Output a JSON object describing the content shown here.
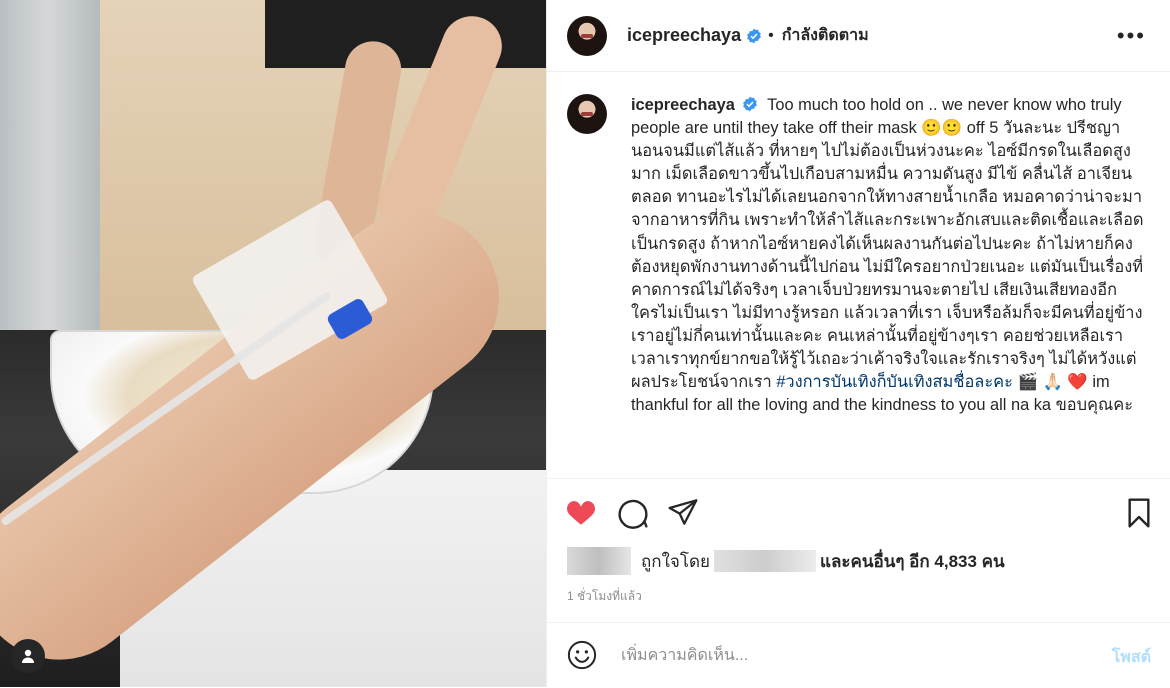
{
  "post": {
    "username": "icepreechaya",
    "follow_status": "กำลังติดตาม",
    "more_menu": "•••",
    "caption_username": "icepreechaya",
    "caption_body": "Too much too hold on .. we never know who truly people are until they take off their mask 🙂🙂 off 5 วันละนะ ปรีชญา นอนจนมีแต่ไส้แล้ว ที่หายๆ ไปไม่ต้องเป็นห่วงนะคะ ไอซ์มีกรดในเลือดสูงมาก เม็ดเลือดขาวขึ้นไปเกือบสามหมื่น ความดันสูง มีไข้ คลื่นไส้ อาเจียน ตลอด ทานอะไรไม่ได้เลยนอกจากให้ทางสายน้ำเกลือ หมอคาดว่าน่าจะมาจากอาหารที่กิน เพราะทำให้ลำไส้และกระเพาะอักเสบและติดเชื้อและเลือดเป็นกรดสูง ถ้าหากไอซ์หายคงได้เห็นผลงานกันต่อไปนะคะ ถ้าไม่หายก็คงต้องหยุดพักงานทางด้านนี้ไปก่อน ไม่มีใครอยากป่วยเนอะ แต่มันเป็นเรื่องที่คาดการณ์ไม่ได้จริงๆ เวลาเจ็บป่วยทรมานจะตายไป เสียเงินเสียทองอีก ใครไม่เป็นเรา ไม่มีทางรู้หรอก แล้วเวลาที่เรา เจ็บหรือล้มก็จะมีคนที่อยู่ข้างเราอยู่ไม่กี่คนเท่านั้นและคะ คนเหล่านั้นที่อยู่ข้างๆเรา คอยช่วยเหลือเราเวลาเราทุกข์ยากขอให้รู้ไว้เถอะว่าเค้าจริงใจและรักเราจริงๆ ไม่ได้หวังแต่ผลประโยชน์จากเรา",
    "hashtag": "#วงการบันเทิงก็บันเทิงสมชื่อละคะ",
    "emojis": "🎬 🙏🏻",
    "heart": "❤️",
    "caption_tail": "im thankful for all the loving and the kindness to you all na ka ขอบคุณคะ",
    "likes_prefix": "ถูกใจโดย",
    "likes_suffix_label": "และคนอื่นๆ อีก 4,833 คน",
    "timestamp": "1 ชั่วโมงที่แล้ว",
    "comment_placeholder": "เพิ่มความคิดเห็น...",
    "post_button": "โพสต์"
  },
  "colors": {
    "like_red": "#ed4956",
    "verified_blue": "#3897f0",
    "hashtag_blue": "#00376b",
    "post_disabled": "#b2dffc"
  },
  "icons": [
    "user-tag-icon",
    "verified-icon",
    "more-icon",
    "like-icon",
    "comment-icon",
    "share-icon",
    "save-icon",
    "emoji-icon"
  ]
}
